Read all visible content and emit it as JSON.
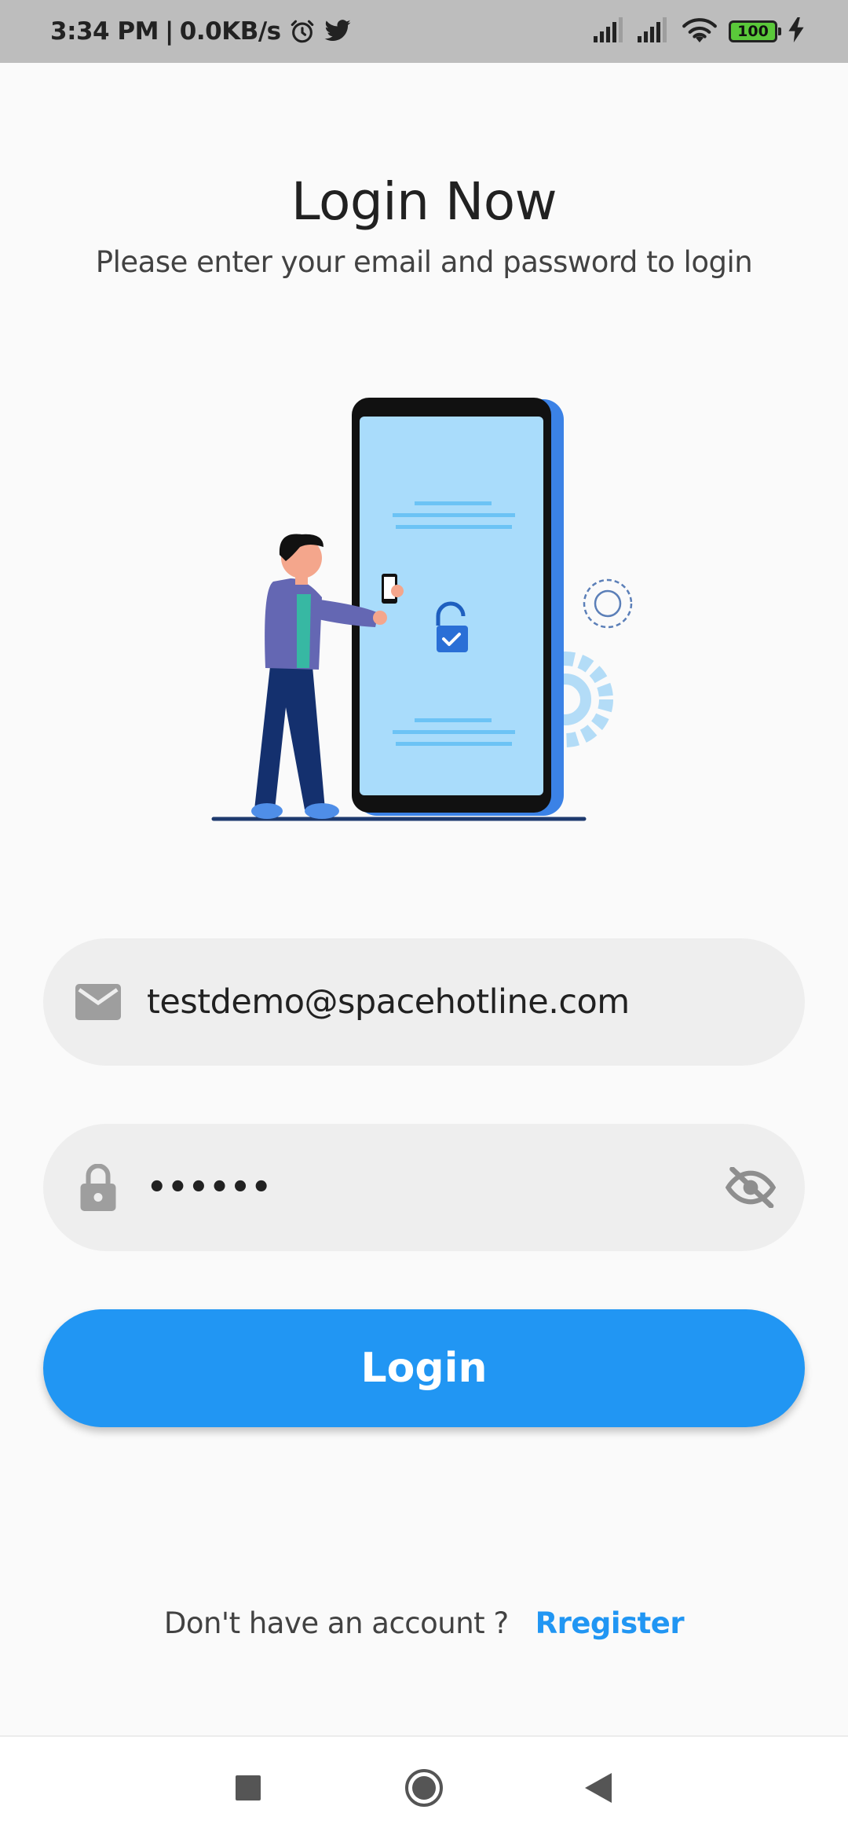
{
  "status_bar": {
    "time": "3:34 PM",
    "network_speed": "0.0KB/s",
    "separator": "|",
    "battery_level": "100",
    "icons": [
      "alarm-icon",
      "twitter-icon",
      "signal-icon",
      "signal-icon",
      "wifi-icon",
      "battery-icon",
      "charging-icon"
    ]
  },
  "header": {
    "title": "Login Now",
    "subtitle": "Please enter your email and password to login"
  },
  "illustration": {
    "icon": "person-unlocking-phone-illustration"
  },
  "form": {
    "email": {
      "value": "testdemo@spacehotline.com",
      "icon": "email-icon"
    },
    "password": {
      "masked_value": "••••••",
      "icon": "lock-icon",
      "toggle_icon": "visibility-off-icon"
    },
    "login_label": "Login"
  },
  "footer": {
    "prompt": "Don't have an account ?",
    "register_label": "Rregister"
  },
  "nav_bar": {
    "icons": [
      "recent-apps-icon",
      "home-icon",
      "back-icon"
    ]
  },
  "colors": {
    "accent": "#2196f3",
    "field_bg": "#eeeeee",
    "background": "#fafafa",
    "status_bar": "#bdbdbd"
  }
}
